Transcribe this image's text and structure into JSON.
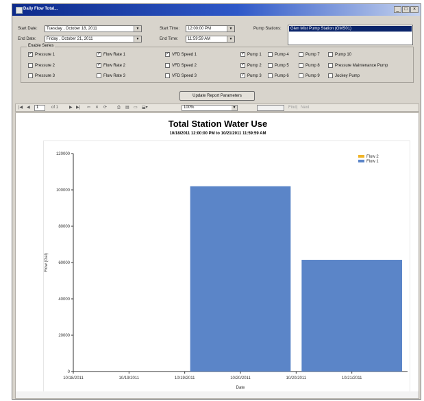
{
  "window": {
    "title": "Daily Flow Total..."
  },
  "filters": {
    "start_date_label": "Start Date:",
    "start_date_value": "Tuesday ,  October  18, 2011",
    "end_date_label": "End Date:",
    "end_date_value": "Friday  ,  October  21, 2011",
    "start_time_label": "Start Time:",
    "start_time_value": "12:00:00 PM",
    "end_time_label": "End Time:",
    "end_time_value": "11:59:59 AM",
    "pump_stations_label": "Pump Stations:",
    "pump_station_selected": "Glen Mist Pump Station (GMS01)"
  },
  "series_group": {
    "title": "Enable Series",
    "checkboxes": [
      {
        "label": "Pressure 1",
        "checked": true
      },
      {
        "label": "Pressure 2",
        "checked": false
      },
      {
        "label": "Pressure 3",
        "checked": false
      },
      {
        "label": "Flow Rate 1",
        "checked": true
      },
      {
        "label": "Flow Rate 2",
        "checked": true
      },
      {
        "label": "Flow Rate 3",
        "checked": false
      },
      {
        "label": "VFD Speed 1",
        "checked": true
      },
      {
        "label": "VFD Speed 2",
        "checked": false
      },
      {
        "label": "VFD Speed 3",
        "checked": false
      },
      {
        "label": "Pump 1",
        "checked": true
      },
      {
        "label": "Pump 2",
        "checked": true
      },
      {
        "label": "Pump 3",
        "checked": true
      },
      {
        "label": "Pump 4",
        "checked": false
      },
      {
        "label": "Pump 5",
        "checked": false
      },
      {
        "label": "Pump 6",
        "checked": false
      },
      {
        "label": "Pump 7",
        "checked": false
      },
      {
        "label": "Pump 8",
        "checked": false
      },
      {
        "label": "Pump 9",
        "checked": false
      },
      {
        "label": "Pump 10",
        "checked": false
      },
      {
        "label": "Pressure Maintenance Pump",
        "checked": false
      },
      {
        "label": "Jockey Pump",
        "checked": false
      }
    ]
  },
  "update_button": "Update Report Parameters",
  "toolbar": {
    "page_current": "1",
    "page_of": "of 1",
    "zoom": "100%",
    "find_label": "Find",
    "next_label": "Next"
  },
  "report": {
    "title": "Total Station Water Use",
    "subtitle": "10/18/2011 12:00:00 PM to 10/21/2011 11:59:59 AM"
  },
  "colors": {
    "flow1": "#5b85c8",
    "flow2": "#f0b428"
  },
  "chart_data": {
    "type": "bar",
    "title": "Total Station Water Use",
    "subtitle": "10/18/2011 12:00:00 PM to 10/21/2011 11:59:59 AM",
    "xlabel": "Date",
    "ylabel": "Flow (Gal)",
    "ylim": [
      0,
      120000
    ],
    "y_ticks": [
      "0",
      "20000",
      "40000",
      "60000",
      "80000",
      "100000",
      "120000"
    ],
    "x_ticks": [
      "10/18/2011",
      "10/19/2011",
      "10/19/2011",
      "10/20/2011",
      "10/20/2011",
      "10/21/2011"
    ],
    "legend": [
      "Flow 2",
      "Flow 1"
    ],
    "legend_position": "top-right",
    "series": [
      {
        "name": "Flow 1",
        "color": "#5b85c8",
        "bars": [
          {
            "start": "10/19/2011 12:00 PM",
            "end": "10/20/2011 12:00 PM",
            "value": 102000
          },
          {
            "start": "10/20/2011 12:00 PM",
            "end": "10/21/2011 12:00 PM",
            "value": 61500
          }
        ]
      },
      {
        "name": "Flow 2",
        "color": "#f0b428",
        "bars": []
      }
    ]
  }
}
